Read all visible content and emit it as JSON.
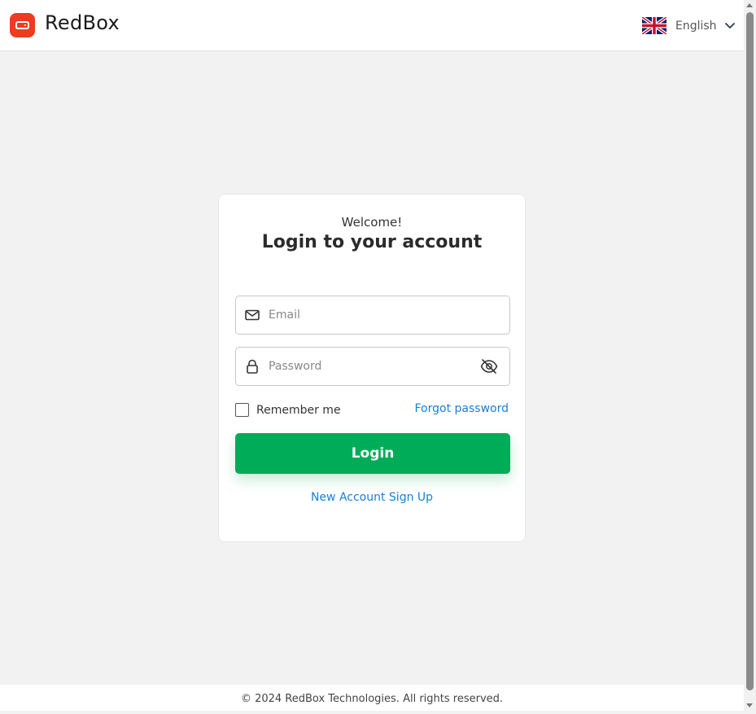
{
  "header": {
    "brand": "RedBox",
    "language": {
      "label": "English",
      "flag_icon": "uk-flag-icon"
    }
  },
  "login": {
    "welcome": "Welcome!",
    "title": "Login to your account",
    "email": {
      "placeholder": "Email",
      "value": ""
    },
    "password": {
      "placeholder": "Password",
      "value": ""
    },
    "remember_label": "Remember me",
    "remember_checked": false,
    "forgot_label": "Forgot password",
    "login_label": "Login",
    "signup_label": "New Account Sign Up"
  },
  "footer": {
    "text": "© 2024 RedBox Technologies. All rights reserved."
  },
  "colors": {
    "brand": "#ee3b22",
    "primary_button": "#00ac58",
    "link": "#1a7fd6",
    "page_background": "#f2f2f2"
  }
}
